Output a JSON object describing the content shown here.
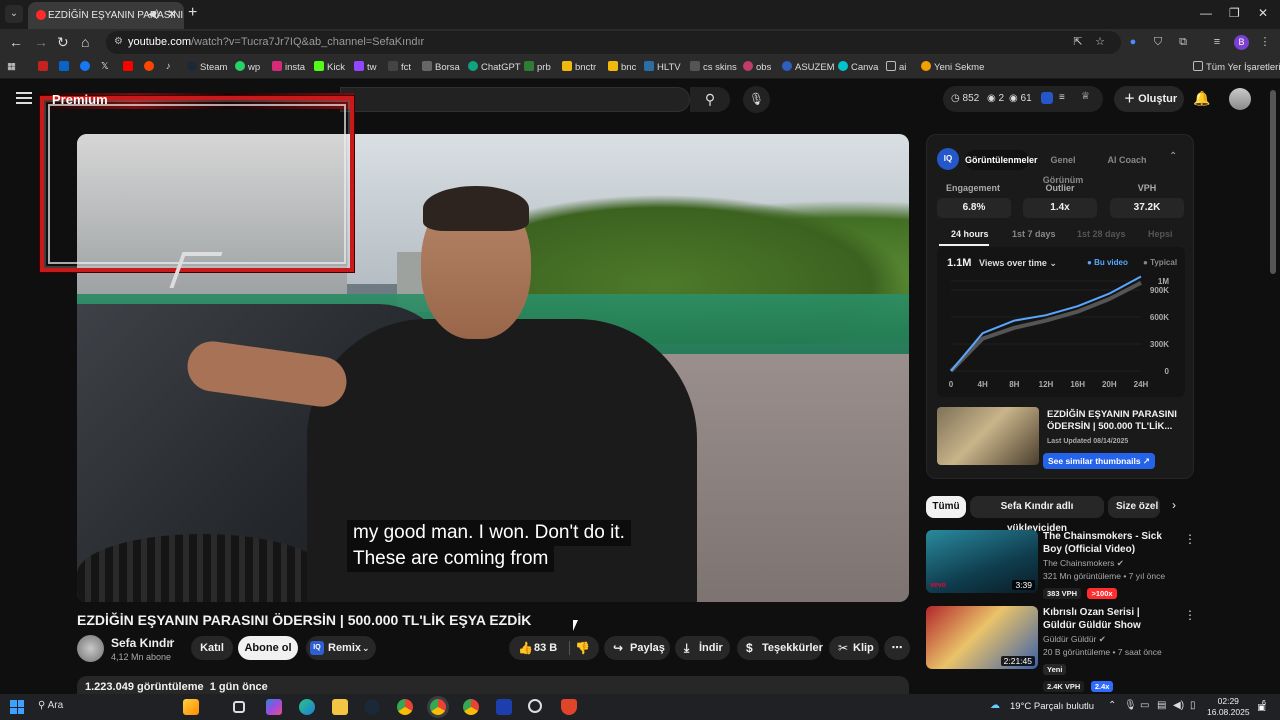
{
  "browser": {
    "tab_title": "EZDİĞİN EŞYANIN PARASINI",
    "url_host": "youtube.com",
    "url_path": "/watch?v=Tucra7Jr7IQ&ab_channel=SefaKındır",
    "bookmarks": [
      "Steam",
      "wp",
      "insta",
      "Kick",
      "tw",
      "fct",
      "Borsa",
      "ChatGPT",
      "prb",
      "bnctr",
      "bnc",
      "HLTV",
      "cs skins",
      "obs",
      "ASUZEM",
      "Canva",
      "ai",
      "Yeni Sekme"
    ],
    "all_bookmarks": "Tüm Yer İşaretleri",
    "profile_initial": "B"
  },
  "youtube": {
    "premium_label": "Premium",
    "stats": {
      "a": "852",
      "b": "2",
      "c": "61"
    },
    "create_label": "Oluştur",
    "video": {
      "title": "EZDİĞİN EŞYANIN PARASINI ÖDERSİN | 500.000 TL'LİK EŞYA EZDİK",
      "captions": [
        "my good man.  I won.  Don't do it.",
        "These are coming from"
      ],
      "channel": "Sefa Kındır",
      "subscribers": "4,12 Mn abone",
      "join_label": "Katıl",
      "subscribe_label": "Abone ol",
      "remix_label": "Remix",
      "likes": "83 B",
      "share_label": "Paylaş",
      "download_label": "İndir",
      "thanks_label": "Teşekkürler",
      "clip_label": "Klip",
      "views": "1.223.049 görüntüleme",
      "age": "1 gün önce"
    },
    "extension": {
      "tabs": [
        "Görüntülenmeler",
        "Genel Görünüm",
        "AI Coach"
      ],
      "metrics": [
        {
          "label": "Engagement",
          "value": "6.8%"
        },
        {
          "label": "Outlier",
          "value": "1.4x"
        },
        {
          "label": "VPH",
          "value": "37.2K"
        }
      ],
      "ranges": [
        "24 hours",
        "1st 7 days",
        "1st 28 days",
        "Hepsi"
      ],
      "chart_total": "1.1M",
      "chart_metric": "Views over time",
      "legend_this": "Bu video",
      "legend_typical": "Typical",
      "video_title": "EZDİĞİN EŞYANIN PARASINI ÖDERSİN | 500.000 TL'LİK...",
      "last_updated": "Last Updated 08/14/2025",
      "similar_label": "See similar thumbnails"
    },
    "chart_data": {
      "type": "line",
      "x": [
        "0",
        "4H",
        "8H",
        "12H",
        "16H",
        "20H",
        "24H"
      ],
      "ylim": [
        0,
        1000000
      ],
      "yticks": [
        "0",
        "300K",
        "600K",
        "900K",
        "1M"
      ],
      "series": [
        {
          "name": "Bu video",
          "color": "#5aa7ff",
          "values": [
            0,
            420000,
            560000,
            620000,
            720000,
            860000,
            1050000
          ]
        },
        {
          "name": "Typical",
          "color": "#555555",
          "values": [
            0,
            360000,
            480000,
            560000,
            660000,
            800000,
            980000
          ]
        }
      ]
    },
    "chips": [
      "Tümü",
      "Sefa Kındır adlı yükleyiciden",
      "Size özel"
    ],
    "recommended": [
      {
        "title": "The Chainsmokers - Sick Boy (Official Video)",
        "channel": "The Chainsmokers",
        "meta": "321 Mn görüntüleme • 7 yıl önce",
        "duration": "3:39",
        "vph": "383 VPH",
        "badge": ">100x",
        "badge_color": "#ff2d2d"
      },
      {
        "title": "Kıbrıslı Ozan Serisi | Güldür Güldür Show",
        "channel": "Güldür Güldür",
        "meta": "20 B görüntüleme • 7 saat önce",
        "duration": "2:21:45",
        "new_label": "Yeni",
        "vph": "2.4K VPH",
        "badge": "2.4x",
        "badge_color": "#2f6bff"
      }
    ]
  },
  "taskbar": {
    "search_label": "Ara",
    "weather": "19°C  Parçalı bulutlu",
    "time": "02:29",
    "date": "16.08.2025",
    "notifications": "6"
  }
}
